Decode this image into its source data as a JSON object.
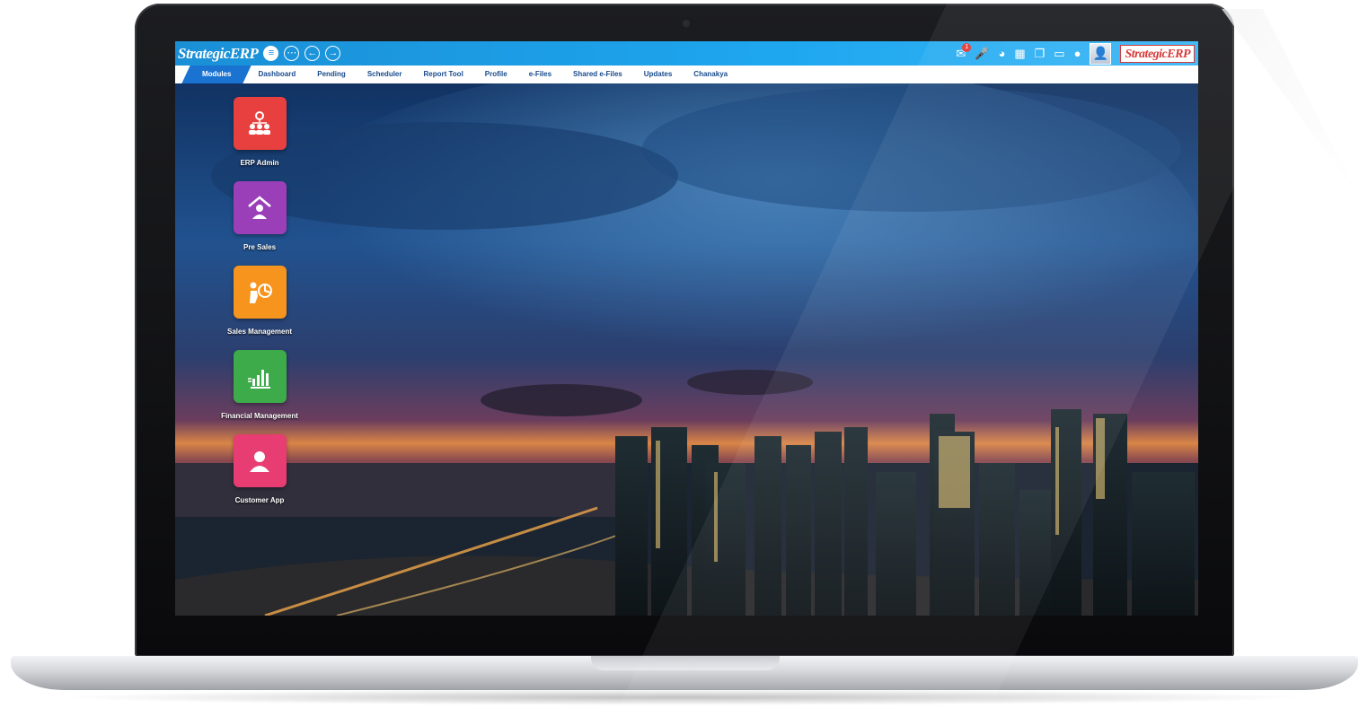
{
  "app": {
    "logo_text": "StrategicERP",
    "brand_text": "StrategicERP",
    "notification_count": "1"
  },
  "toolbar": {
    "menu_icon": "hamburger-icon",
    "more_icon": "more-icon",
    "back_icon": "arrow-left-icon",
    "forward_icon": "arrow-right-icon",
    "right_icons": [
      "mail-icon",
      "microphone-icon",
      "pie-chart-icon",
      "calculator-icon",
      "windows-icon",
      "monitor-icon",
      "globe-icon"
    ]
  },
  "menu": {
    "items": [
      {
        "label": "Modules",
        "active": true
      },
      {
        "label": "Dashboard"
      },
      {
        "label": "Pending"
      },
      {
        "label": "Scheduler"
      },
      {
        "label": "Report Tool"
      },
      {
        "label": "Profile"
      },
      {
        "label": "e-Files"
      },
      {
        "label": "Shared e-Files"
      },
      {
        "label": "Updates"
      },
      {
        "label": "Chanakya"
      }
    ]
  },
  "modules": [
    {
      "label": "ERP Admin",
      "color": "#e8403f",
      "icon": "org-chart-icon"
    },
    {
      "label": "Pre Sales",
      "color": "#9b3fb8",
      "icon": "home-user-icon"
    },
    {
      "label": "Sales Management",
      "color": "#f7941d",
      "icon": "presentation-icon"
    },
    {
      "label": "Financial Management",
      "color": "#3dab4a",
      "icon": "bar-chart-icon"
    },
    {
      "label": "Customer App",
      "color": "#e83d73",
      "icon": "user-icon"
    }
  ],
  "colors": {
    "topbar": "#1ea7ef",
    "menu_active": "#1a73d1",
    "menu_text": "#174a8c"
  }
}
